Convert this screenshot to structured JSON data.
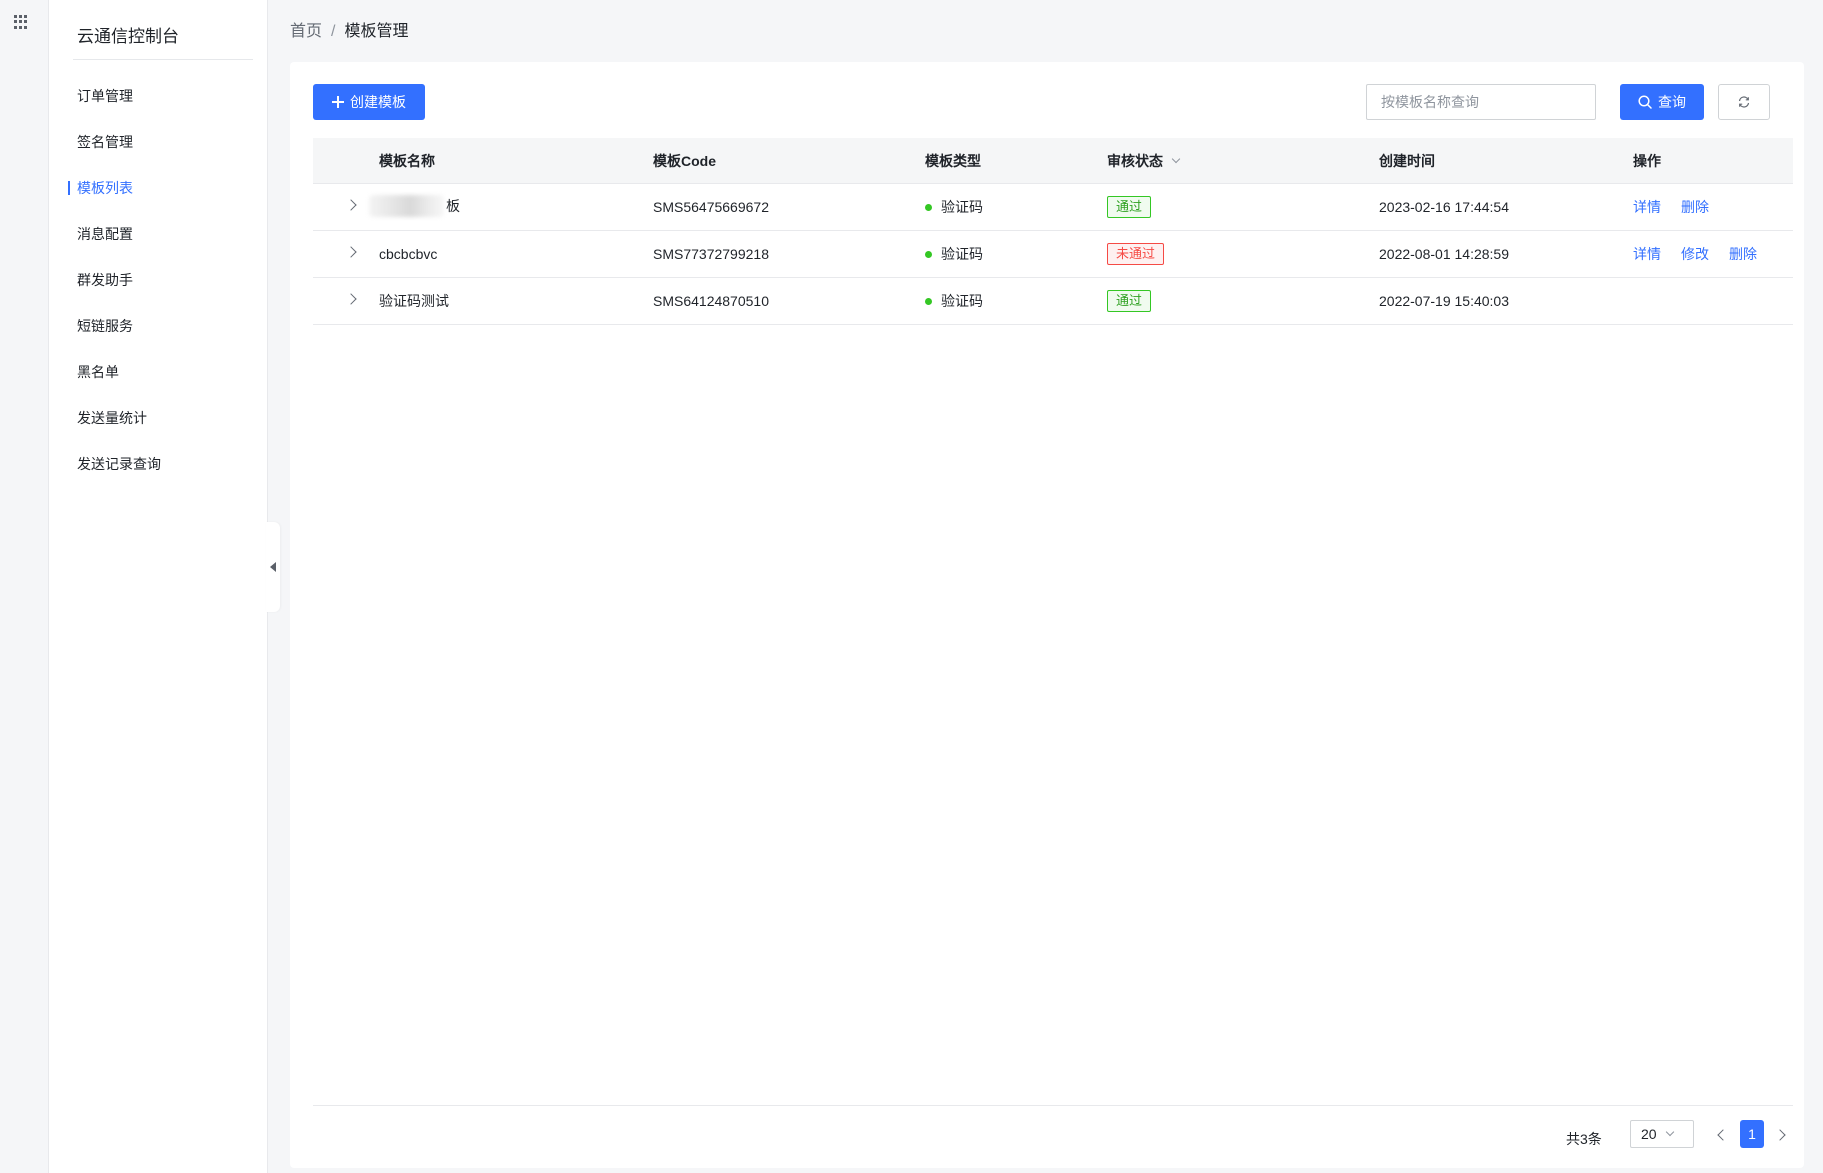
{
  "sidebar": {
    "title": "云通信控制台",
    "items": [
      {
        "label": "订单管理",
        "active": false
      },
      {
        "label": "签名管理",
        "active": false
      },
      {
        "label": "模板列表",
        "active": true
      },
      {
        "label": "消息配置",
        "active": false
      },
      {
        "label": "群发助手",
        "active": false
      },
      {
        "label": "短链服务",
        "active": false
      },
      {
        "label": "黑名单",
        "active": false
      },
      {
        "label": "发送量统计",
        "active": false
      },
      {
        "label": "发送记录查询",
        "active": false
      }
    ]
  },
  "breadcrumb": {
    "home": "首页",
    "separator": "/",
    "current": "模板管理"
  },
  "toolbar": {
    "create_label": "创建模板",
    "search_placeholder": "按模板名称查询",
    "query_label": "查询"
  },
  "table": {
    "headers": {
      "name": "模板名称",
      "code": "模板Code",
      "type": "模板类型",
      "status": "审核状态",
      "time": "创建时间",
      "ops": "操作"
    },
    "rows": [
      {
        "name": "板",
        "code": "SMS56475669672",
        "type": "验证码",
        "status": "通过",
        "time": "2023-02-16 17:44:54",
        "ops": [
          "详情",
          "删除"
        ]
      },
      {
        "name": "cbcbcbvc",
        "code": "SMS77372799218",
        "type": "验证码",
        "status": "未通过",
        "time": "2022-08-01 14:28:59",
        "ops": [
          "详情",
          "修改",
          "删除"
        ]
      },
      {
        "name": "验证码测试",
        "code": "SMS64124870510",
        "type": "验证码",
        "status": "通过",
        "time": "2022-07-19 15:40:03",
        "ops": []
      }
    ]
  },
  "pagination": {
    "total": "共3条",
    "page_size": "20",
    "current_page": "1"
  },
  "colors": {
    "primary": "#3370ff",
    "success": "#34c724",
    "danger": "#f54a45"
  }
}
